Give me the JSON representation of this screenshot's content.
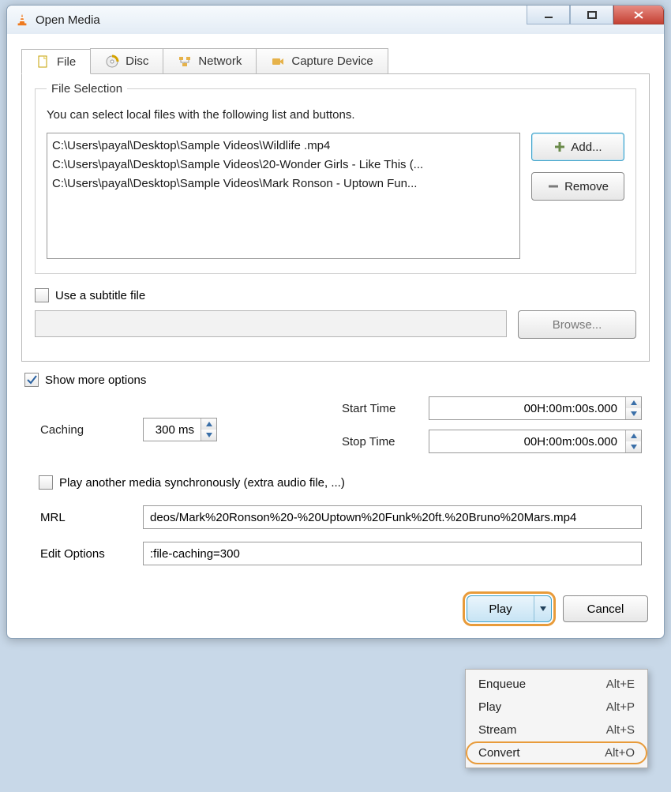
{
  "window": {
    "title": "Open Media"
  },
  "tabs": [
    {
      "label": "File",
      "icon": "file-icon"
    },
    {
      "label": "Disc",
      "icon": "disc-icon"
    },
    {
      "label": "Network",
      "icon": "network-icon"
    },
    {
      "label": "Capture Device",
      "icon": "capture-icon"
    }
  ],
  "fileSelection": {
    "legend": "File Selection",
    "hint": "You can select local files with the following list and buttons.",
    "files": [
      "C:\\Users\\payal\\Desktop\\Sample Videos\\Wildlife .mp4",
      "C:\\Users\\payal\\Desktop\\Sample Videos\\20-Wonder Girls - Like This (...",
      "C:\\Users\\payal\\Desktop\\Sample Videos\\Mark Ronson - Uptown Fun..."
    ],
    "add_label": "Add...",
    "remove_label": "Remove"
  },
  "subtitle": {
    "check_label": "Use a subtitle file",
    "browse_label": "Browse...",
    "path": ""
  },
  "showMore": {
    "label": "Show more options",
    "checked": true
  },
  "options": {
    "caching_label": "Caching",
    "caching_value": "300 ms",
    "start_label": "Start Time",
    "start_value": "00H:00m:00s.000",
    "stop_label": "Stop Time",
    "stop_value": "00H:00m:00s.000",
    "sync_label": "Play another media synchronously (extra audio file, ...)",
    "mrl_label": "MRL",
    "mrl_value": "deos/Mark%20Ronson%20-%20Uptown%20Funk%20ft.%20Bruno%20Mars.mp4",
    "edit_label": "Edit Options",
    "edit_value": ":file-caching=300"
  },
  "buttons": {
    "play": "Play",
    "cancel": "Cancel"
  },
  "menu": [
    {
      "label": "Enqueue",
      "accel": "Alt+E"
    },
    {
      "label": "Play",
      "accel": "Alt+P"
    },
    {
      "label": "Stream",
      "accel": "Alt+S"
    },
    {
      "label": "Convert",
      "accel": "Alt+O"
    }
  ]
}
